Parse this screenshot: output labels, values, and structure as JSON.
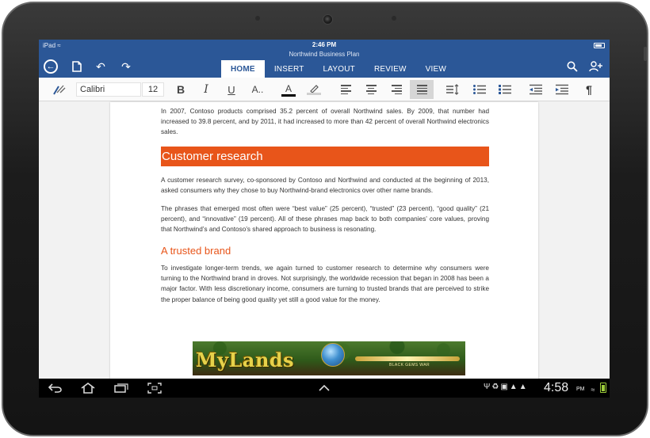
{
  "status_bar": {
    "device": "iPad",
    "time": "2:46 PM"
  },
  "document": {
    "title": "Northwind Business Plan"
  },
  "tabs": [
    {
      "label": "HOME",
      "active": true
    },
    {
      "label": "INSERT",
      "active": false
    },
    {
      "label": "LAYOUT",
      "active": false
    },
    {
      "label": "REVIEW",
      "active": false
    },
    {
      "label": "VIEW",
      "active": false
    }
  ],
  "ribbon": {
    "font_name": "Calibri",
    "font_size": "12",
    "bold": "B",
    "italic": "I",
    "underline": "U",
    "text_effects": "A..",
    "font_color": "A",
    "paragraph_mark": "¶"
  },
  "content": {
    "para1": "In 2007, Contoso products comprised 35.2 percent of overall Northwind sales. By 2009, that number had increased to 39.8 percent, and by 2011, it had increased to more than 42 percent of overall Northwind electronics sales.",
    "heading1": "Customer research",
    "para2": "A customer research survey, co-sponsored by Contoso and Northwind and conducted at the beginning of 2013, asked consumers why they chose to buy Northwind-brand electronics over other name brands.",
    "para3": "The phrases that emerged most often were “best value” (25 percent), “trusted” (23 percent), “good quality” (21 percent), and “innovative” (19 percent). All of these phrases map back to both companies’ core values, proving that Northwind’s and Contoso’s shared approach to business is resonating.",
    "heading2": "A trusted brand",
    "para4": "To investigate longer-term trends, we again turned to customer research to determine why consumers were turning to the Northwind brand in droves. Not surprisingly, the worldwide recession that began in 2008 has been a major factor. With less discretionary income, consumers are turning to trusted brands that are perceived to strike the proper balance of being good quality yet still a good value for the money."
  },
  "banner": {
    "title": "MyLands",
    "subtitle": "BLACK GEMS WAR"
  },
  "android_bar": {
    "time": "4:58",
    "ampm": "PM"
  },
  "colors": {
    "app_blue": "#2b5797",
    "heading_orange": "#e8551a",
    "battery_green": "#9ccc3a"
  }
}
